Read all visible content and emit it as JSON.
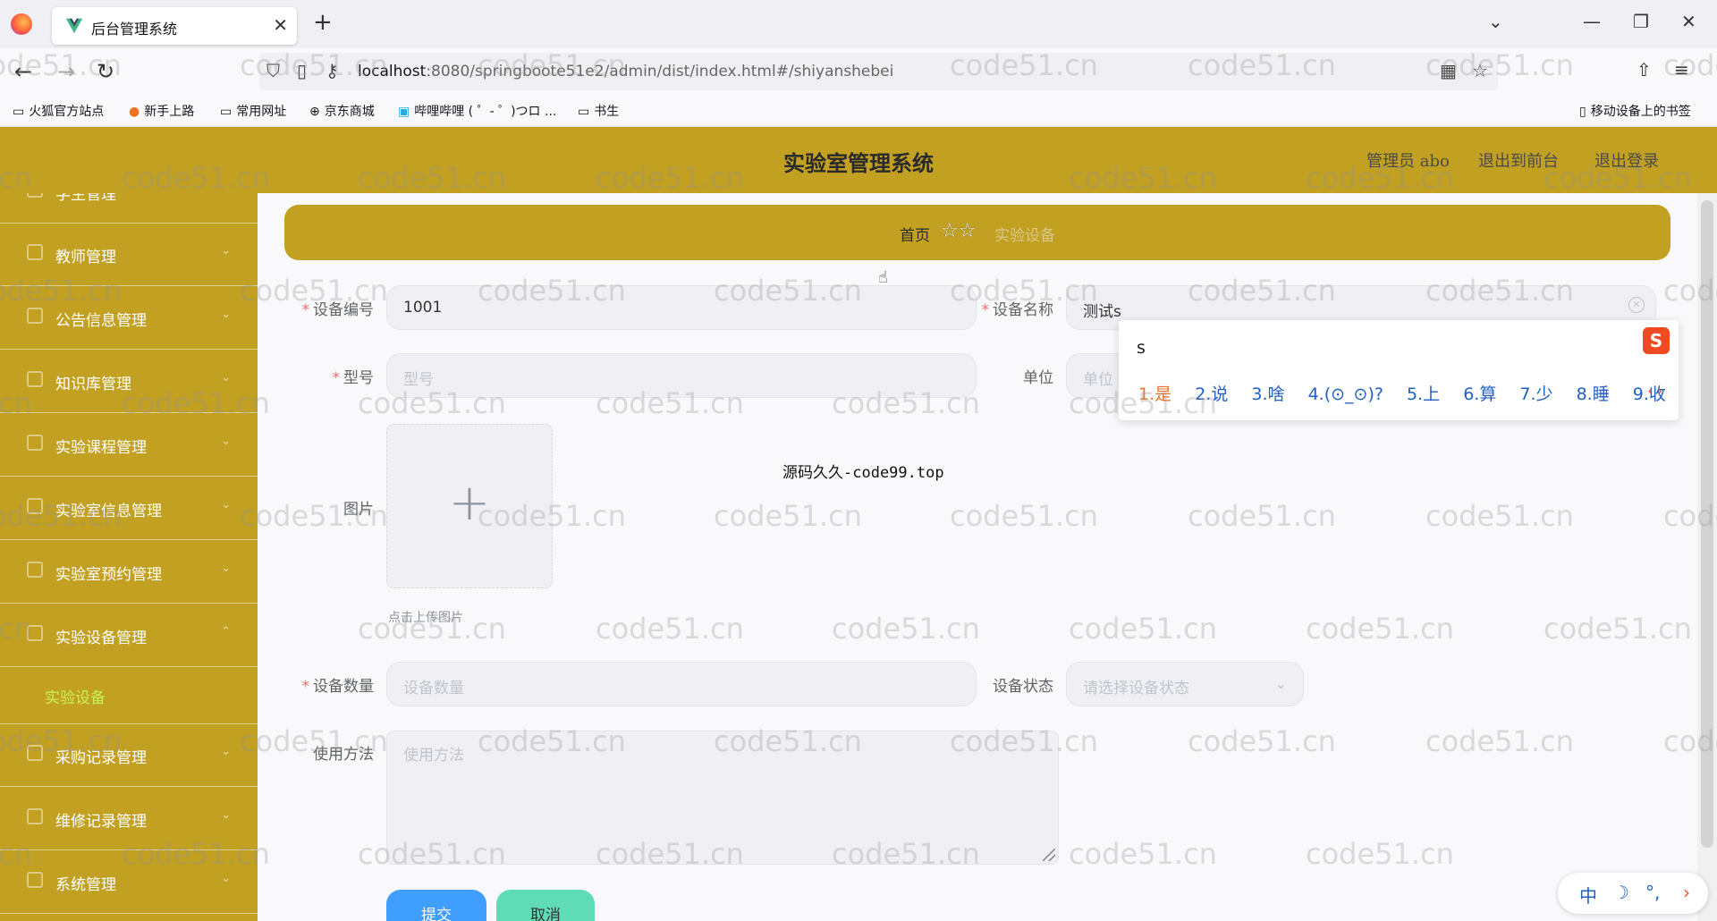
{
  "browser": {
    "tab_title": "后台管理系统",
    "url_host": "localhost",
    "url_rest": ":8080/springboote51e2/admin/dist/index.html#/shiyanshebei",
    "bookmarks": [
      "火狐官方站点",
      "新手上路",
      "常用网址",
      "京东商城",
      "哔哩哔哩 ( ゜- ゜)つロ ...",
      "书生"
    ],
    "mobile_bookmarks": "移动设备上的书签"
  },
  "header": {
    "title": "实验室管理系统",
    "user_label": "管理员 abo",
    "front_link": "退出到前台",
    "logout_link": "退出登录"
  },
  "sidebar": {
    "items": [
      {
        "label": "学生管理"
      },
      {
        "label": "教师管理"
      },
      {
        "label": "公告信息管理"
      },
      {
        "label": "知识库管理"
      },
      {
        "label": "实验课程管理"
      },
      {
        "label": "实验室信息管理"
      },
      {
        "label": "实验室预约管理"
      },
      {
        "label": "实验设备管理"
      },
      {
        "label": "采购记录管理"
      },
      {
        "label": "维修记录管理"
      },
      {
        "label": "系统管理"
      }
    ],
    "active_sub": "实验设备"
  },
  "breadcrumb": {
    "home": "首页",
    "current": "实验设备"
  },
  "form": {
    "device_no_label": "设备编号",
    "device_no_value": "1001",
    "device_name_label": "设备名称",
    "device_name_value": "测试s",
    "model_label": "型号",
    "model_placeholder": "型号",
    "unit_label": "单位",
    "unit_placeholder": "单位",
    "image_label": "图片",
    "upload_tip": "点击上传图片",
    "qty_label": "设备数量",
    "qty_placeholder": "设备数量",
    "status_label": "设备状态",
    "status_placeholder": "请选择设备状态",
    "usage_label": "使用方法",
    "usage_placeholder": "使用方法",
    "submit": "提交",
    "cancel": "取消"
  },
  "overlay_text": "源码久久-code99.top",
  "ime": {
    "input": "s",
    "candidates": [
      "1.是",
      "2.说",
      "3.啥",
      "4.(⊙_⊙)?",
      "5.上",
      "6.算",
      "7.少",
      "8.睡",
      "9.收"
    ],
    "bar": [
      "中",
      "☽",
      "°,",
      "›"
    ]
  },
  "watermark": "code51.cn"
}
